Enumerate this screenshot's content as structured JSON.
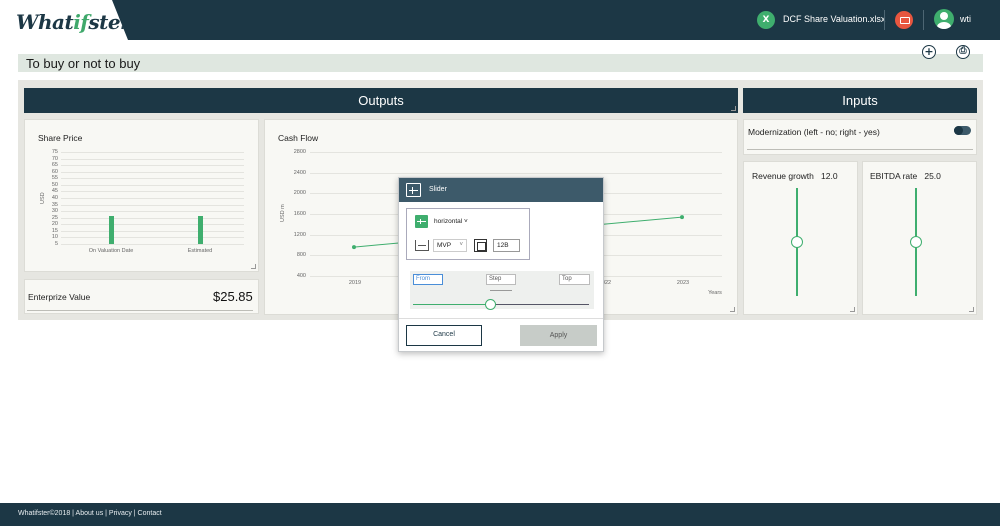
{
  "app": {
    "logo_main": "What",
    "logo_if": "if",
    "logo_rest": "ster",
    "file_icon": "excel-icon",
    "file_name": "DCF Share Valuation.xlsx",
    "user_name": "wti"
  },
  "page": {
    "title": "To buy or not to buy",
    "add_label": "+",
    "save_label": "⎙"
  },
  "outputs": {
    "header": "Outputs",
    "share_price": {
      "title": "Share Price",
      "y_axis_label": "USD",
      "y_ticks": [
        "75",
        "70",
        "65",
        "60",
        "55",
        "50",
        "45",
        "40",
        "35",
        "30",
        "25",
        "20",
        "15",
        "10",
        "5"
      ]
    },
    "cash_flow": {
      "title": "Cash Flow",
      "y_axis_label": "USD m",
      "y_ticks": [
        "2800",
        "2400",
        "2000",
        "1600",
        "1200",
        "800",
        "400"
      ],
      "x_ticks": [
        "2019",
        "2022",
        "2023"
      ],
      "x_axis_label": "Years"
    },
    "enterprise_value": {
      "label": "Enterprize Value",
      "value": "$25.85"
    }
  },
  "chart_data": [
    {
      "type": "bar",
      "title": "Share Price",
      "ylabel": "USD",
      "categories": [
        "On Valuation Date",
        "Estimated"
      ],
      "values": [
        26,
        26
      ],
      "ylim": [
        5,
        75
      ]
    },
    {
      "type": "line",
      "title": "Cash Flow",
      "ylabel": "USD m",
      "xlabel": "Years",
      "x": [
        2019,
        2023
      ],
      "values": [
        960,
        1540
      ],
      "ylim": [
        400,
        2800
      ]
    }
  ],
  "inputs": {
    "header": "Inputs",
    "modernization_label": "Modernization (left - no; right - yes)",
    "revenue_growth": {
      "label": "Revenue growth",
      "value": "12.0"
    },
    "ebitda_rate": {
      "label": "EBITDA rate",
      "value": "25.0"
    }
  },
  "popup": {
    "title": "Slider",
    "orientation": "horizontal",
    "size_select": "MVP",
    "size_value": "12B",
    "from_placeholder": "From",
    "step_placeholder": "Step",
    "top_placeholder": "Top",
    "cancel_label": "Cancel",
    "apply_label": "Apply"
  },
  "footer": {
    "text": "Whatifster©2018 | About us | Privacy | Contact"
  }
}
